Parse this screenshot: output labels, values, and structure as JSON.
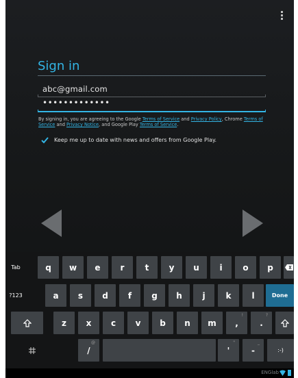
{
  "header": {
    "title": "Sign in"
  },
  "fields": {
    "email_value": "abc@gmail.com",
    "password_value": "•••••••••••••"
  },
  "legal": {
    "t1": "By signing in, you are agreeing to the Google ",
    "terms1": "Terms of Service",
    "t2": " and ",
    "privacy1": "Privacy Policy",
    "t3": ", Chrome ",
    "terms2": "Terms of Service",
    "t4": " and ",
    "privacy2": "Privacy Notice",
    "t5": ", and Google Play ",
    "terms3": "Terms of Service",
    "t6": "."
  },
  "newsletter": {
    "label": "Keep me up to date with news and offers from Google Play.",
    "checked": true
  },
  "keyboard": {
    "row1": [
      "q",
      "w",
      "e",
      "r",
      "t",
      "y",
      "u",
      "i",
      "o",
      "p"
    ],
    "row2": [
      "a",
      "s",
      "d",
      "f",
      "g",
      "h",
      "j",
      "k",
      "l"
    ],
    "row3": [
      "z",
      "x",
      "c",
      "v",
      "b",
      "n",
      "m"
    ],
    "tab_label": "Tab",
    "numbers_label": "?123",
    "done_label": "Done",
    "comma": ",",
    "comma_hint": "!",
    "period": ".",
    "period_hint": "?",
    "slash": "/",
    "slash_hint": "@",
    "apostrophe": "'",
    "apostrophe_hint": "\"",
    "dash": "-",
    "dash_hint": "_",
    "smiley": ":-)"
  },
  "status_bar": {
    "network": "ENGlab"
  },
  "colors": {
    "accent": "#33b5e5",
    "key": "#3f4347",
    "done": "#1f6d93"
  },
  "icons": [
    "overflow-menu-icon",
    "checkbox-checked-icon",
    "back-arrow-icon",
    "next-arrow-icon",
    "shift-icon",
    "backspace-icon",
    "settings-icon",
    "wifi-icon",
    "battery-icon"
  ]
}
